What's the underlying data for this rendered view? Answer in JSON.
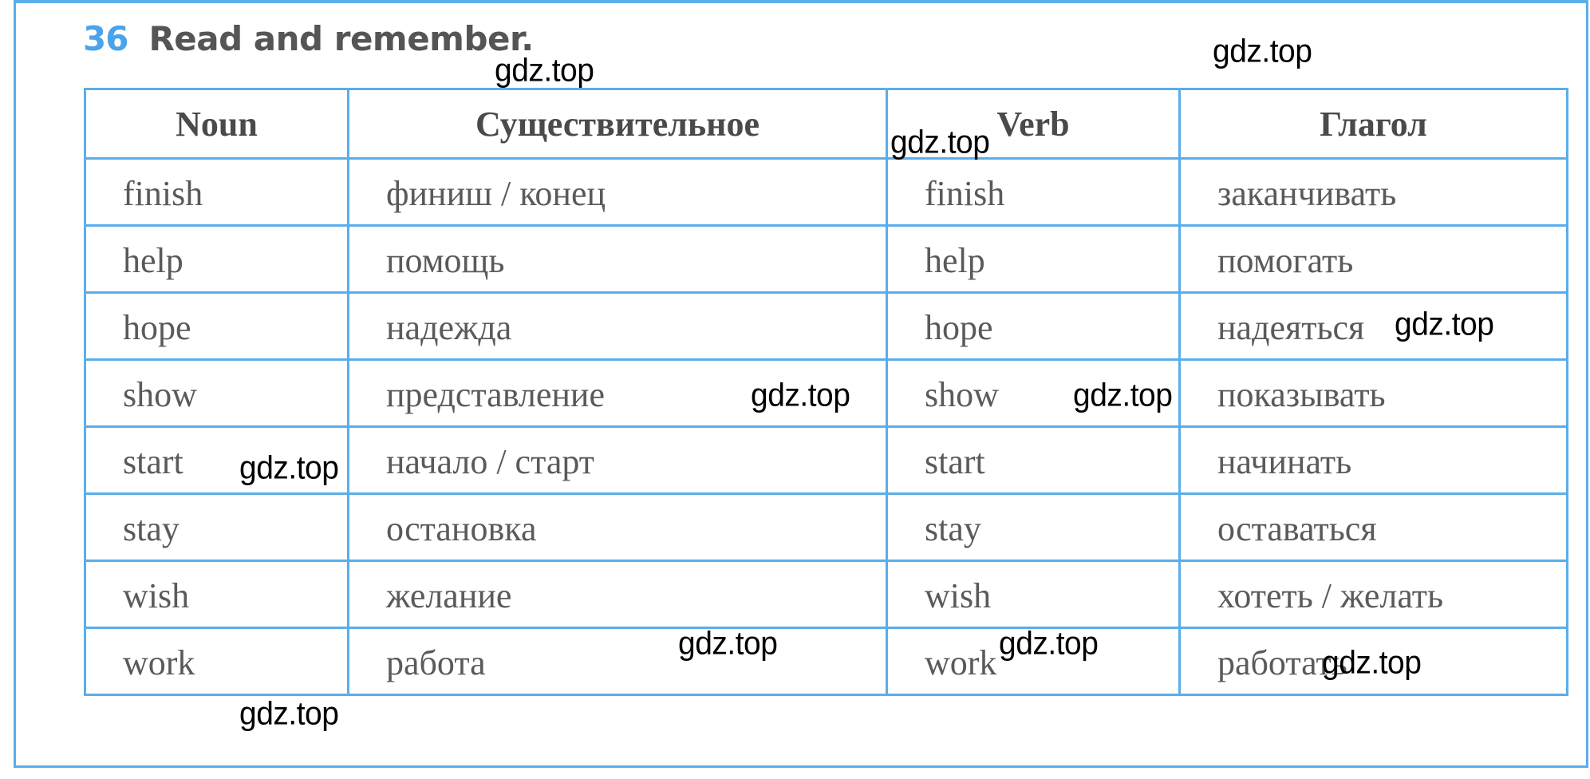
{
  "exercise": {
    "number": "36",
    "instruction": "Read and remember."
  },
  "colors": {
    "accent": "#4ba3ea",
    "border": "#5aaeea",
    "text": "#5a5a5a",
    "header_text": "#4a4a4a"
  },
  "table": {
    "headers": [
      "Noun",
      "Существительное",
      "Verb",
      "Глагол"
    ],
    "rows": [
      [
        "finish",
        "финиш / конец",
        "finish",
        "заканчивать"
      ],
      [
        "help",
        "помощь",
        "help",
        "помогать"
      ],
      [
        "hope",
        "надежда",
        "hope",
        "надеяться"
      ],
      [
        "show",
        "представление",
        "show",
        "показывать"
      ],
      [
        "start",
        "начало / старт",
        "start",
        "начинать"
      ],
      [
        "stay",
        "остановка",
        "stay",
        "оставаться"
      ],
      [
        "wish",
        "желание",
        "wish",
        "хотеть / желать"
      ],
      [
        "work",
        "работа",
        "work",
        "работать"
      ]
    ]
  },
  "watermarks": [
    "gdz.top",
    "gdz.top",
    "gdz.top",
    "gdz.top",
    "gdz.top",
    "gdz.top",
    "gdz.top",
    "gdz.top",
    "gdz.top",
    "gdz.top",
    "gdz.top"
  ]
}
